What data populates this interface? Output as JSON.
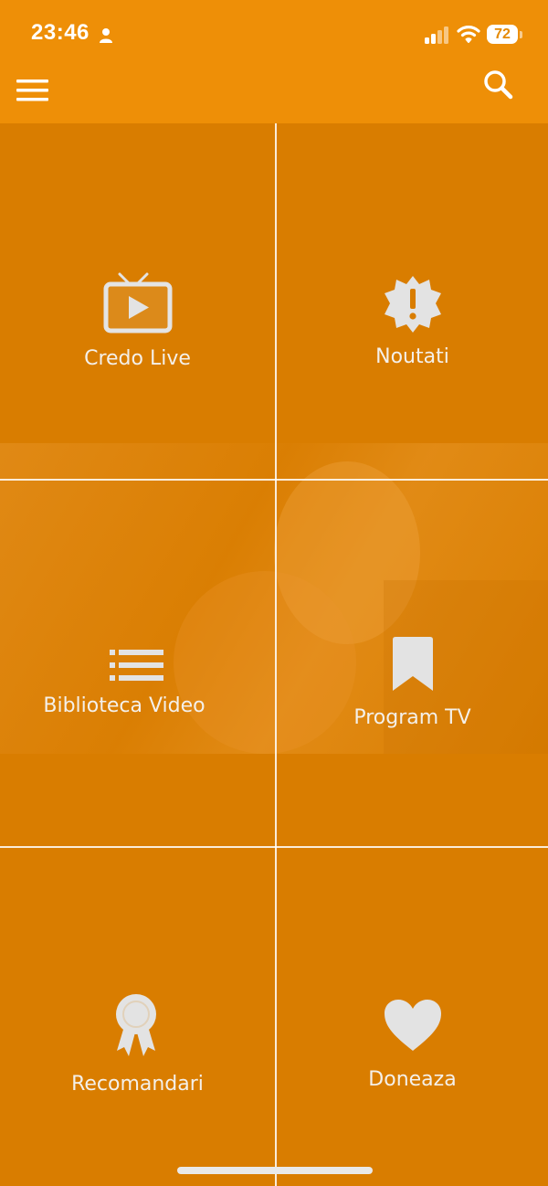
{
  "status_bar": {
    "time": "23:46",
    "battery": "72",
    "icons": [
      "person-icon",
      "signal-icon",
      "wifi-icon",
      "battery-icon"
    ]
  },
  "app_bar": {
    "menu_icon": "hamburger-menu-icon",
    "search_icon": "search-icon"
  },
  "colors": {
    "status_bar_bg": "#ee8f07",
    "grid_bg": "#d97d00",
    "icon_color": "#e2e2e2",
    "label_color": "#f4f0ea"
  },
  "tiles": [
    {
      "label": "Credo Live",
      "icon": "tv-play-icon"
    },
    {
      "label": "Noutati",
      "icon": "alert-badge-icon"
    },
    {
      "label": "Biblioteca Video",
      "icon": "list-icon"
    },
    {
      "label": "Program TV",
      "icon": "bookmark-icon"
    },
    {
      "label": "Recomandari",
      "icon": "award-ribbon-icon"
    },
    {
      "label": "Doneaza",
      "icon": "heart-icon"
    }
  ]
}
